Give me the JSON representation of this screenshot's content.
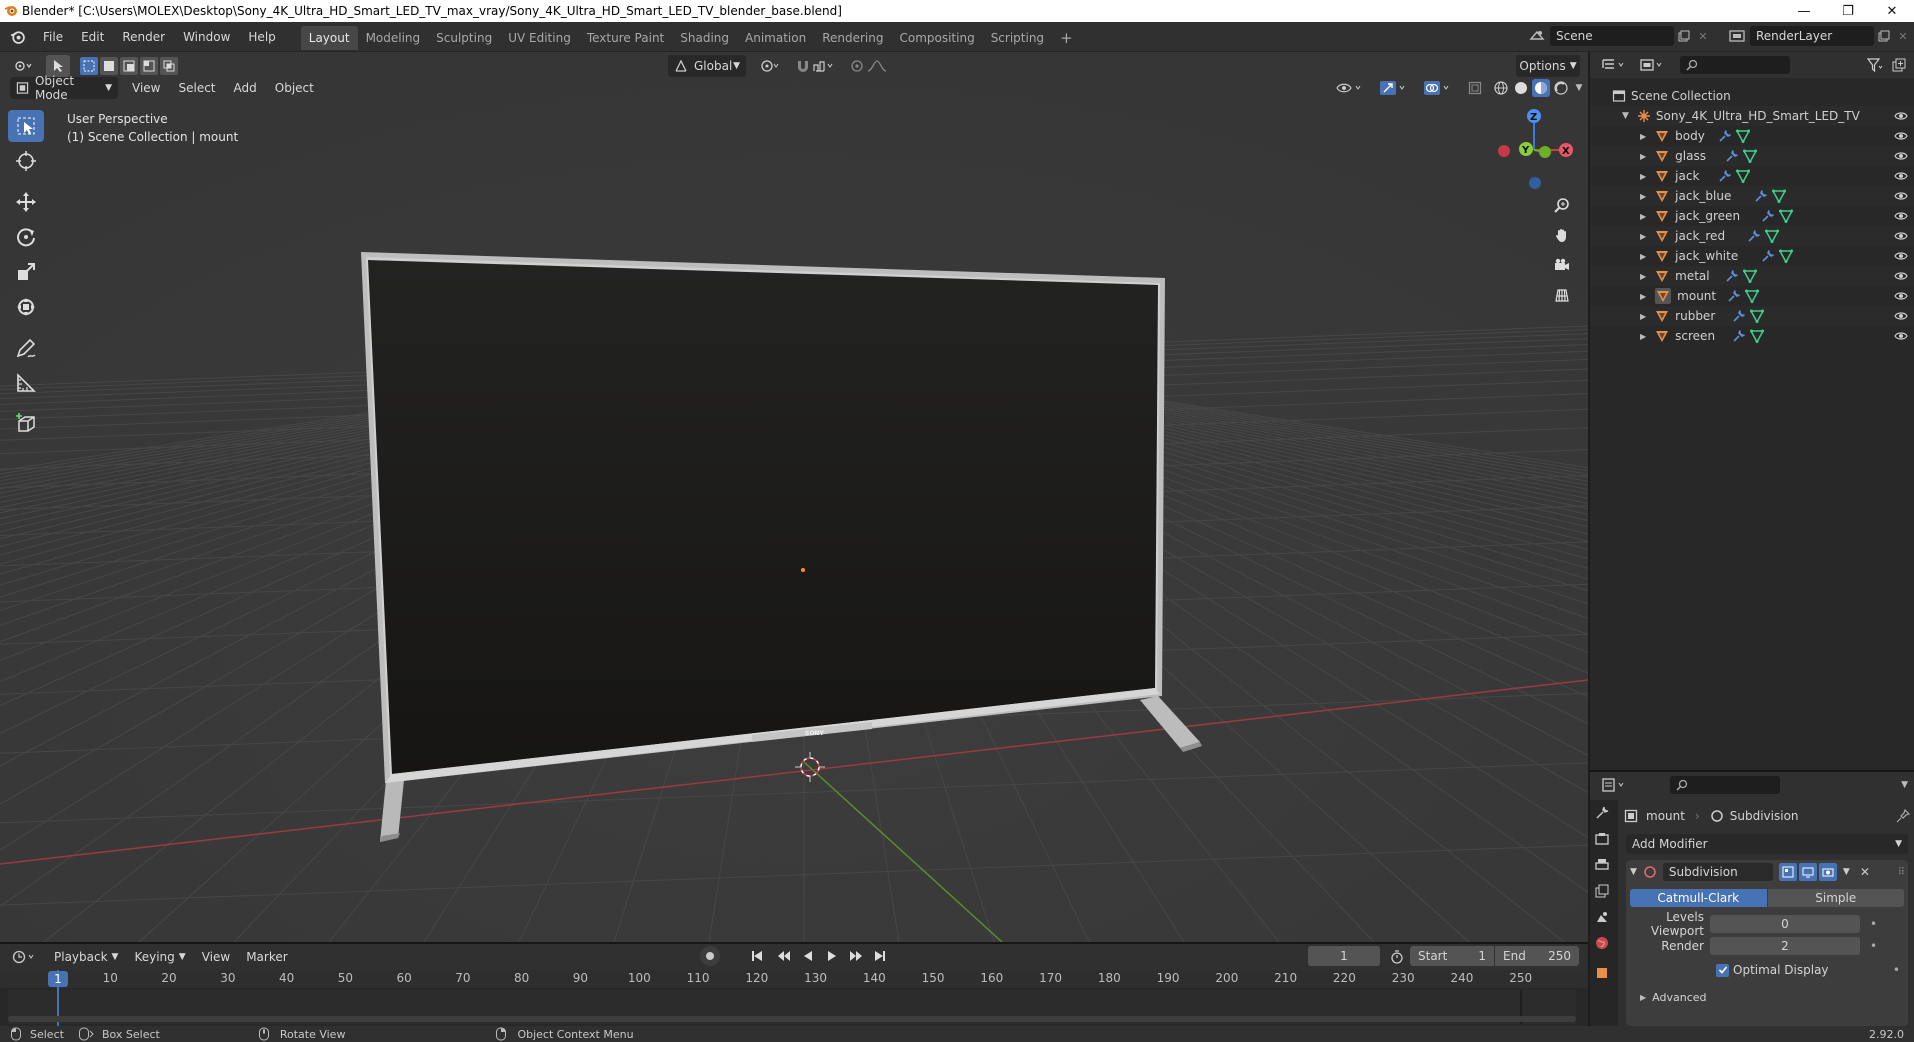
{
  "titlebar": {
    "title": "Blender* [C:\\Users\\MOLEX\\Desktop\\Sony_4K_Ultra_HD_Smart_LED_TV_max_vray/Sony_4K_Ultra_HD_Smart_LED_TV_blender_base.blend]",
    "minimize_glyph": "—",
    "restore_glyph": "❐",
    "close_glyph": "✕"
  },
  "menubar": {
    "items": [
      "File",
      "Edit",
      "Render",
      "Window",
      "Help"
    ]
  },
  "workspaces": {
    "tabs": [
      "Layout",
      "Modeling",
      "Sculpting",
      "UV Editing",
      "Texture Paint",
      "Shading",
      "Animation",
      "Rendering",
      "Compositing",
      "Scripting"
    ],
    "active": "Layout",
    "add_glyph": "+"
  },
  "scene": {
    "scene_name": "Scene",
    "view_layer": "RenderLayer"
  },
  "tool_header": {
    "orientation": "Global",
    "options_label": "Options"
  },
  "viewport_header": {
    "mode": "Object Mode",
    "menus": [
      "View",
      "Select",
      "Add",
      "Object"
    ]
  },
  "viewport": {
    "perspective_label": "User Perspective",
    "collection_label": "(1) Scene Collection | mount",
    "brand_text": "SONY",
    "gizmo_axes": {
      "z": "Z",
      "y": "Y",
      "x": "X"
    }
  },
  "outliner": {
    "root": "Scene Collection",
    "collection": "Sony_4K_Ultra_HD_Smart_LED_TV",
    "objects": [
      "body",
      "glass",
      "jack",
      "jack_blue",
      "jack_green",
      "jack_red",
      "jack_white",
      "metal",
      "mount",
      "rubber",
      "screen"
    ],
    "selected": "mount"
  },
  "properties": {
    "object_name": "mount",
    "modifier_crumb": "Subdivision",
    "add_modifier_label": "Add Modifier",
    "modifier_name": "Subdivision",
    "algo_options": [
      "Catmull-Clark",
      "Simple"
    ],
    "algo_active": "Catmull-Clark",
    "levels_viewport_label": "Levels Viewport",
    "levels_viewport_value": "0",
    "render_label": "Render",
    "render_value": "2",
    "optimal_display_label": "Optimal Display",
    "advanced_label": "Advanced"
  },
  "timeline": {
    "menus": [
      "Playback",
      "Keying",
      "View",
      "Marker"
    ],
    "current_frame": "1",
    "start_label": "Start",
    "start_value": "1",
    "end_label": "End",
    "end_value": "250",
    "ticks": [
      "1",
      "10",
      "20",
      "30",
      "40",
      "50",
      "60",
      "70",
      "80",
      "90",
      "100",
      "110",
      "120",
      "130",
      "140",
      "150",
      "160",
      "170",
      "180",
      "190",
      "200",
      "210",
      "220",
      "230",
      "240",
      "250"
    ]
  },
  "statusbar": {
    "select": "Select",
    "box_select": "Box Select",
    "rotate_view": "Rotate View",
    "context_menu": "Object Context Menu",
    "version": "2.92.0"
  },
  "colors": {
    "accent": "#4772b3",
    "mesh_orange": "#e8904a",
    "modifier_blue": "#5e8fd8",
    "data_green": "#3fcf8e",
    "axis_x": "#d13a4a",
    "axis_y": "#6bb325",
    "axis_z": "#3a7bd5"
  }
}
